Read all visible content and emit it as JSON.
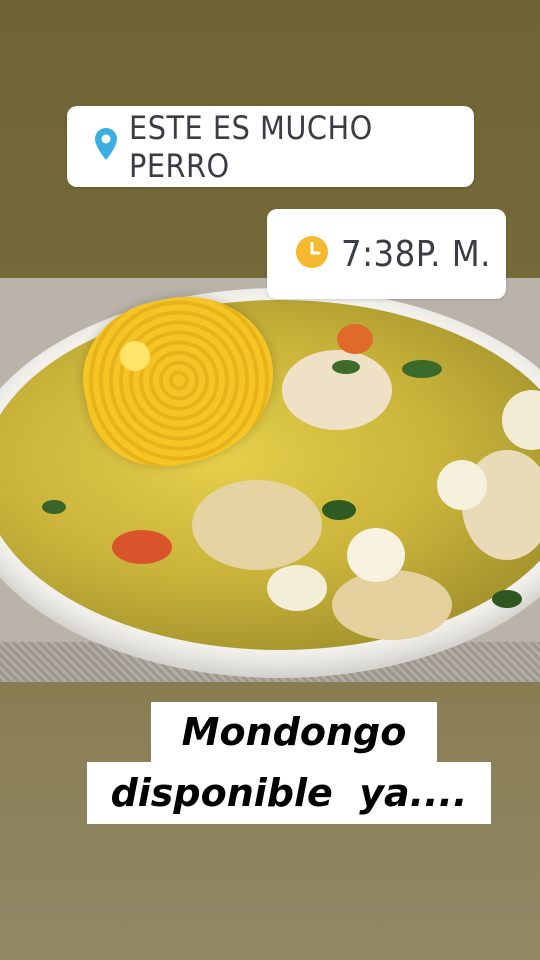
{
  "story": {
    "location_sticker": {
      "icon": "location-pin-icon",
      "text": "ESTE ES MUCHO PERRO",
      "icon_color": "#3aaee0"
    },
    "time_sticker": {
      "icon": "clock-icon",
      "text": "7:38P. M.",
      "icon_color": "#f5b82e"
    },
    "caption": {
      "line_1": "Mondongo",
      "line_2": "disponible  ya...."
    },
    "photo": {
      "subject": "food-photo"
    },
    "colors": {
      "background_top": "#6f6433",
      "background_bottom": "#918867",
      "sticker_bg": "#ffffff",
      "sticker_text": "#3a3d45"
    }
  }
}
